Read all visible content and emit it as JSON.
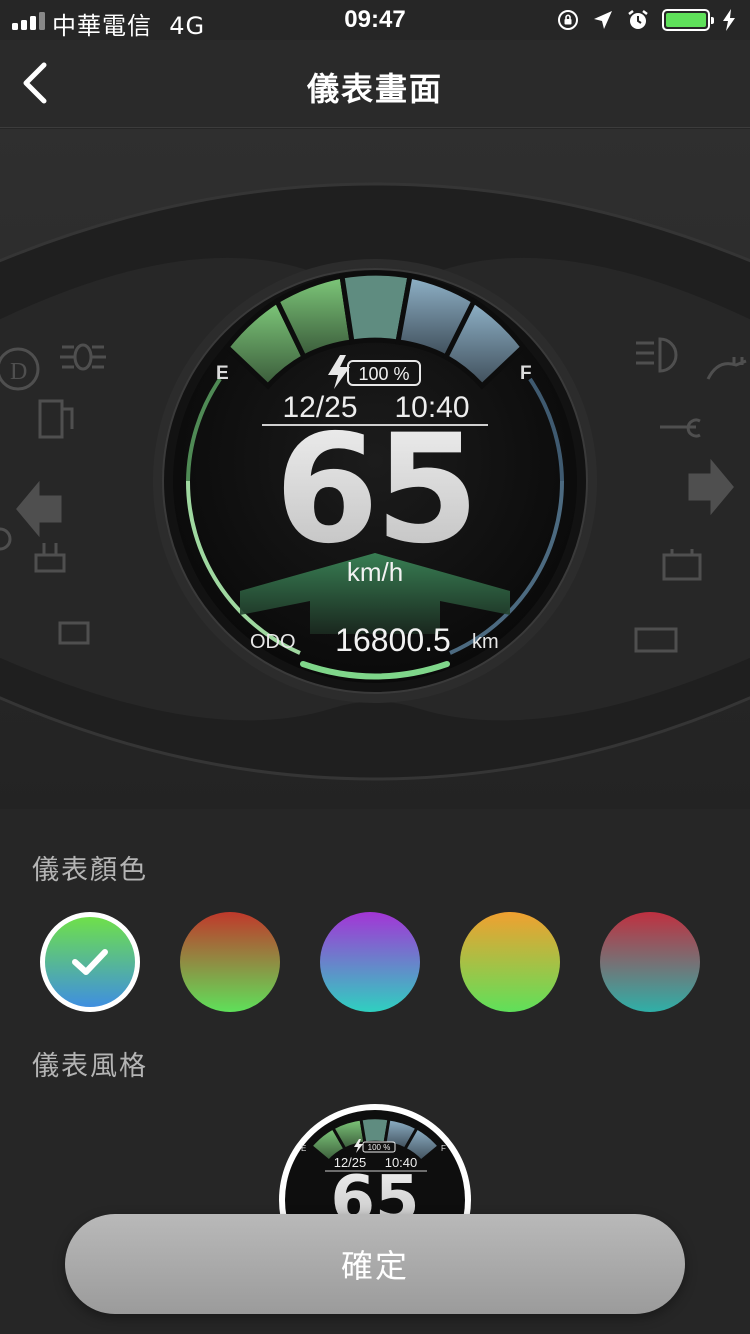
{
  "status_bar": {
    "carrier": "中華電信",
    "network": "4G",
    "time": "09:47",
    "battery_level": 1.0
  },
  "nav": {
    "title": "儀表畫面",
    "back_icon": "chevron-left-icon"
  },
  "gauge": {
    "battery_percent": "100 %",
    "date": "12/25",
    "time": "10:40",
    "speed": "65",
    "speed_unit": "km/h",
    "odo_label": "ODO",
    "odo_value": "16800.5",
    "odo_unit": "km",
    "empty_label": "E",
    "full_label": "F"
  },
  "color_section": {
    "label": "儀表顏色",
    "selected_index": 0,
    "options": [
      {
        "name": "green-blue",
        "top": "#6fe04a",
        "bottom": "#3f8fe0"
      },
      {
        "name": "red-green",
        "top": "#c0392b",
        "bottom": "#5fe05a"
      },
      {
        "name": "purple-teal",
        "top": "#a335d6",
        "bottom": "#2fd0c0"
      },
      {
        "name": "orange-green",
        "top": "#f0a030",
        "bottom": "#5fe05a"
      },
      {
        "name": "crimson-teal",
        "top": "#c03040",
        "bottom": "#2fb0a8"
      }
    ]
  },
  "style_section": {
    "label": "儀表風格"
  },
  "confirm": {
    "label": "確定"
  },
  "colors": {
    "accent_green": "#7fd68a",
    "background": "#262626"
  }
}
